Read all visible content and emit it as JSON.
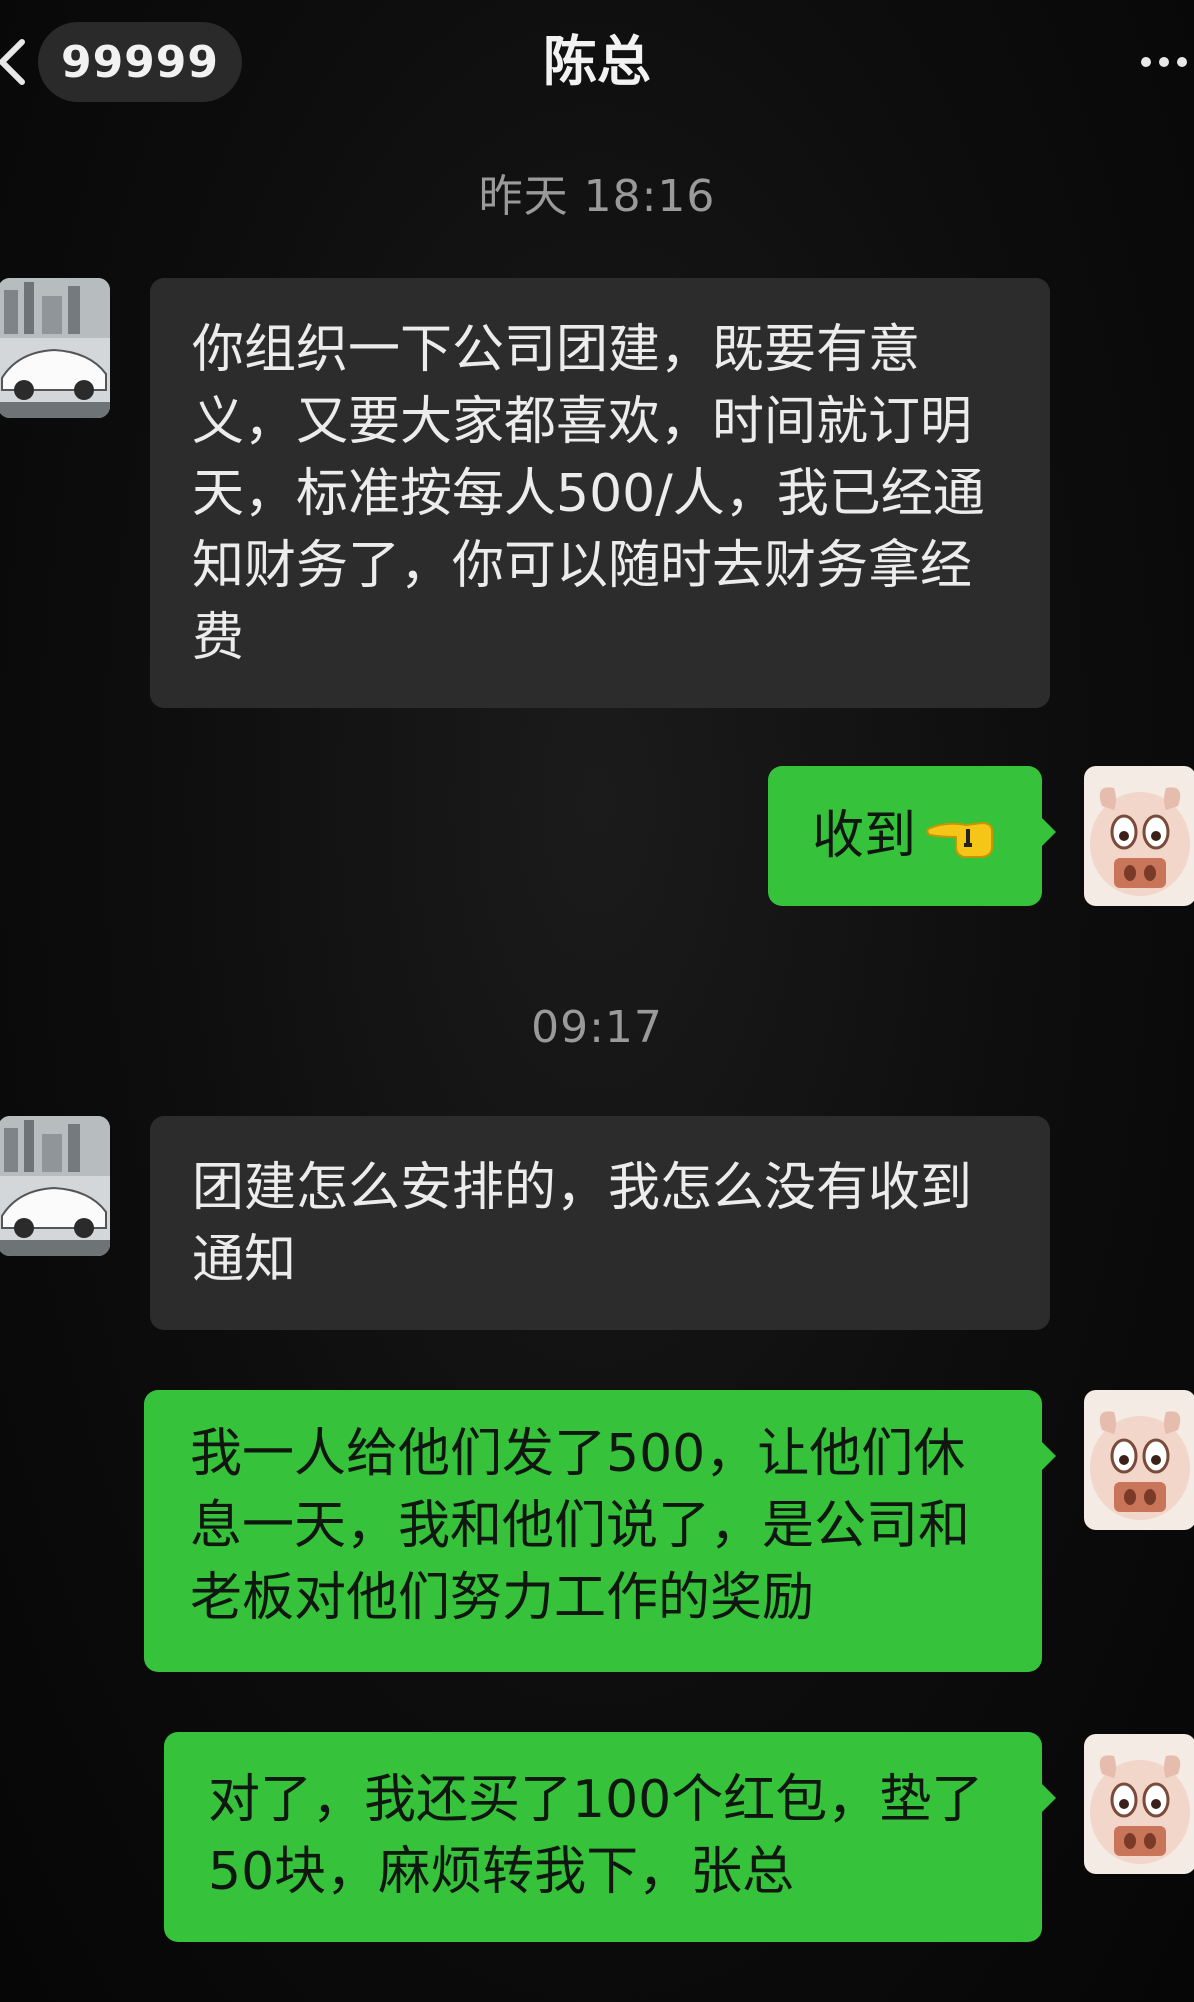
{
  "header": {
    "unread_count": "99999",
    "title": "陈总"
  },
  "timestamps": {
    "first": "昨天 18:16",
    "second": "09:17"
  },
  "messages": [
    {
      "side": "in",
      "text": "你组织一下公司团建，既要有意义，又要大家都喜欢，时间就订明天，标准按每人500/人，我已经通知财务了，你可以随时去财务拿经费"
    },
    {
      "side": "out",
      "text": "收到",
      "emoji": "pointing-hand"
    },
    {
      "side": "in",
      "text": "团建怎么安排的，我怎么没有收到通知"
    },
    {
      "side": "out",
      "text": "我一人给他们发了500，让他们休息一天，我和他们说了，是公司和老板对他们努力工作的奖励"
    },
    {
      "side": "out",
      "text": "对了，我还买了100个红包，垫了50块，麻烦转我下，张总"
    }
  ],
  "colors": {
    "background": "#0b0b0b",
    "incoming_bubble": "#2c2c2c",
    "outgoing_bubble": "#36c23a"
  }
}
